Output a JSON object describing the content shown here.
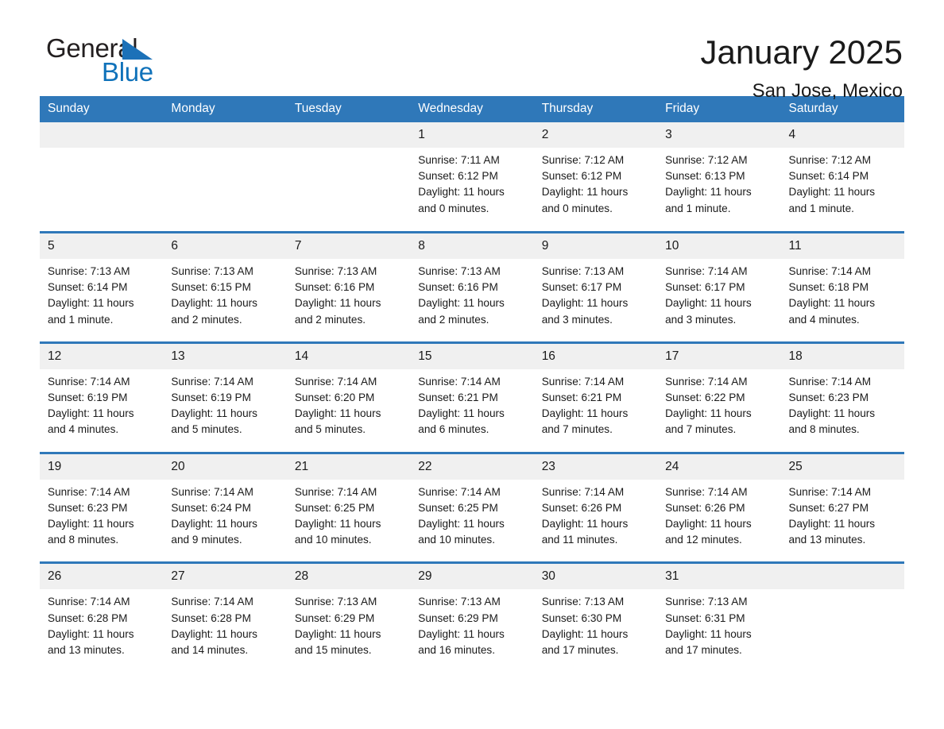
{
  "brand": {
    "name_top": "General",
    "name_bottom": "Blue",
    "triangle_color": "#1c71b8",
    "blue_color": "#1072ba"
  },
  "header": {
    "title": "January 2025",
    "subtitle": "San Jose, Mexico"
  },
  "calendar": {
    "header_bg": "#2f78b9",
    "header_text_color": "#ffffff",
    "daynum_bg": "#f0f0f0",
    "weekdays": [
      "Sunday",
      "Monday",
      "Tuesday",
      "Wednesday",
      "Thursday",
      "Friday",
      "Saturday"
    ],
    "weeks": [
      [
        {
          "date": "",
          "sunrise": "",
          "sunset": "",
          "daylight_1": "",
          "daylight_2": ""
        },
        {
          "date": "",
          "sunrise": "",
          "sunset": "",
          "daylight_1": "",
          "daylight_2": ""
        },
        {
          "date": "",
          "sunrise": "",
          "sunset": "",
          "daylight_1": "",
          "daylight_2": ""
        },
        {
          "date": "1",
          "sunrise": "Sunrise: 7:11 AM",
          "sunset": "Sunset: 6:12 PM",
          "daylight_1": "Daylight: 11 hours",
          "daylight_2": "and 0 minutes."
        },
        {
          "date": "2",
          "sunrise": "Sunrise: 7:12 AM",
          "sunset": "Sunset: 6:12 PM",
          "daylight_1": "Daylight: 11 hours",
          "daylight_2": "and 0 minutes."
        },
        {
          "date": "3",
          "sunrise": "Sunrise: 7:12 AM",
          "sunset": "Sunset: 6:13 PM",
          "daylight_1": "Daylight: 11 hours",
          "daylight_2": "and 1 minute."
        },
        {
          "date": "4",
          "sunrise": "Sunrise: 7:12 AM",
          "sunset": "Sunset: 6:14 PM",
          "daylight_1": "Daylight: 11 hours",
          "daylight_2": "and 1 minute."
        }
      ],
      [
        {
          "date": "5",
          "sunrise": "Sunrise: 7:13 AM",
          "sunset": "Sunset: 6:14 PM",
          "daylight_1": "Daylight: 11 hours",
          "daylight_2": "and 1 minute."
        },
        {
          "date": "6",
          "sunrise": "Sunrise: 7:13 AM",
          "sunset": "Sunset: 6:15 PM",
          "daylight_1": "Daylight: 11 hours",
          "daylight_2": "and 2 minutes."
        },
        {
          "date": "7",
          "sunrise": "Sunrise: 7:13 AM",
          "sunset": "Sunset: 6:16 PM",
          "daylight_1": "Daylight: 11 hours",
          "daylight_2": "and 2 minutes."
        },
        {
          "date": "8",
          "sunrise": "Sunrise: 7:13 AM",
          "sunset": "Sunset: 6:16 PM",
          "daylight_1": "Daylight: 11 hours",
          "daylight_2": "and 2 minutes."
        },
        {
          "date": "9",
          "sunrise": "Sunrise: 7:13 AM",
          "sunset": "Sunset: 6:17 PM",
          "daylight_1": "Daylight: 11 hours",
          "daylight_2": "and 3 minutes."
        },
        {
          "date": "10",
          "sunrise": "Sunrise: 7:14 AM",
          "sunset": "Sunset: 6:17 PM",
          "daylight_1": "Daylight: 11 hours",
          "daylight_2": "and 3 minutes."
        },
        {
          "date": "11",
          "sunrise": "Sunrise: 7:14 AM",
          "sunset": "Sunset: 6:18 PM",
          "daylight_1": "Daylight: 11 hours",
          "daylight_2": "and 4 minutes."
        }
      ],
      [
        {
          "date": "12",
          "sunrise": "Sunrise: 7:14 AM",
          "sunset": "Sunset: 6:19 PM",
          "daylight_1": "Daylight: 11 hours",
          "daylight_2": "and 4 minutes."
        },
        {
          "date": "13",
          "sunrise": "Sunrise: 7:14 AM",
          "sunset": "Sunset: 6:19 PM",
          "daylight_1": "Daylight: 11 hours",
          "daylight_2": "and 5 minutes."
        },
        {
          "date": "14",
          "sunrise": "Sunrise: 7:14 AM",
          "sunset": "Sunset: 6:20 PM",
          "daylight_1": "Daylight: 11 hours",
          "daylight_2": "and 5 minutes."
        },
        {
          "date": "15",
          "sunrise": "Sunrise: 7:14 AM",
          "sunset": "Sunset: 6:21 PM",
          "daylight_1": "Daylight: 11 hours",
          "daylight_2": "and 6 minutes."
        },
        {
          "date": "16",
          "sunrise": "Sunrise: 7:14 AM",
          "sunset": "Sunset: 6:21 PM",
          "daylight_1": "Daylight: 11 hours",
          "daylight_2": "and 7 minutes."
        },
        {
          "date": "17",
          "sunrise": "Sunrise: 7:14 AM",
          "sunset": "Sunset: 6:22 PM",
          "daylight_1": "Daylight: 11 hours",
          "daylight_2": "and 7 minutes."
        },
        {
          "date": "18",
          "sunrise": "Sunrise: 7:14 AM",
          "sunset": "Sunset: 6:23 PM",
          "daylight_1": "Daylight: 11 hours",
          "daylight_2": "and 8 minutes."
        }
      ],
      [
        {
          "date": "19",
          "sunrise": "Sunrise: 7:14 AM",
          "sunset": "Sunset: 6:23 PM",
          "daylight_1": "Daylight: 11 hours",
          "daylight_2": "and 8 minutes."
        },
        {
          "date": "20",
          "sunrise": "Sunrise: 7:14 AM",
          "sunset": "Sunset: 6:24 PM",
          "daylight_1": "Daylight: 11 hours",
          "daylight_2": "and 9 minutes."
        },
        {
          "date": "21",
          "sunrise": "Sunrise: 7:14 AM",
          "sunset": "Sunset: 6:25 PM",
          "daylight_1": "Daylight: 11 hours",
          "daylight_2": "and 10 minutes."
        },
        {
          "date": "22",
          "sunrise": "Sunrise: 7:14 AM",
          "sunset": "Sunset: 6:25 PM",
          "daylight_1": "Daylight: 11 hours",
          "daylight_2": "and 10 minutes."
        },
        {
          "date": "23",
          "sunrise": "Sunrise: 7:14 AM",
          "sunset": "Sunset: 6:26 PM",
          "daylight_1": "Daylight: 11 hours",
          "daylight_2": "and 11 minutes."
        },
        {
          "date": "24",
          "sunrise": "Sunrise: 7:14 AM",
          "sunset": "Sunset: 6:26 PM",
          "daylight_1": "Daylight: 11 hours",
          "daylight_2": "and 12 minutes."
        },
        {
          "date": "25",
          "sunrise": "Sunrise: 7:14 AM",
          "sunset": "Sunset: 6:27 PM",
          "daylight_1": "Daylight: 11 hours",
          "daylight_2": "and 13 minutes."
        }
      ],
      [
        {
          "date": "26",
          "sunrise": "Sunrise: 7:14 AM",
          "sunset": "Sunset: 6:28 PM",
          "daylight_1": "Daylight: 11 hours",
          "daylight_2": "and 13 minutes."
        },
        {
          "date": "27",
          "sunrise": "Sunrise: 7:14 AM",
          "sunset": "Sunset: 6:28 PM",
          "daylight_1": "Daylight: 11 hours",
          "daylight_2": "and 14 minutes."
        },
        {
          "date": "28",
          "sunrise": "Sunrise: 7:13 AM",
          "sunset": "Sunset: 6:29 PM",
          "daylight_1": "Daylight: 11 hours",
          "daylight_2": "and 15 minutes."
        },
        {
          "date": "29",
          "sunrise": "Sunrise: 7:13 AM",
          "sunset": "Sunset: 6:29 PM",
          "daylight_1": "Daylight: 11 hours",
          "daylight_2": "and 16 minutes."
        },
        {
          "date": "30",
          "sunrise": "Sunrise: 7:13 AM",
          "sunset": "Sunset: 6:30 PM",
          "daylight_1": "Daylight: 11 hours",
          "daylight_2": "and 17 minutes."
        },
        {
          "date": "31",
          "sunrise": "Sunrise: 7:13 AM",
          "sunset": "Sunset: 6:31 PM",
          "daylight_1": "Daylight: 11 hours",
          "daylight_2": "and 17 minutes."
        },
        {
          "date": "",
          "sunrise": "",
          "sunset": "",
          "daylight_1": "",
          "daylight_2": ""
        }
      ]
    ]
  }
}
